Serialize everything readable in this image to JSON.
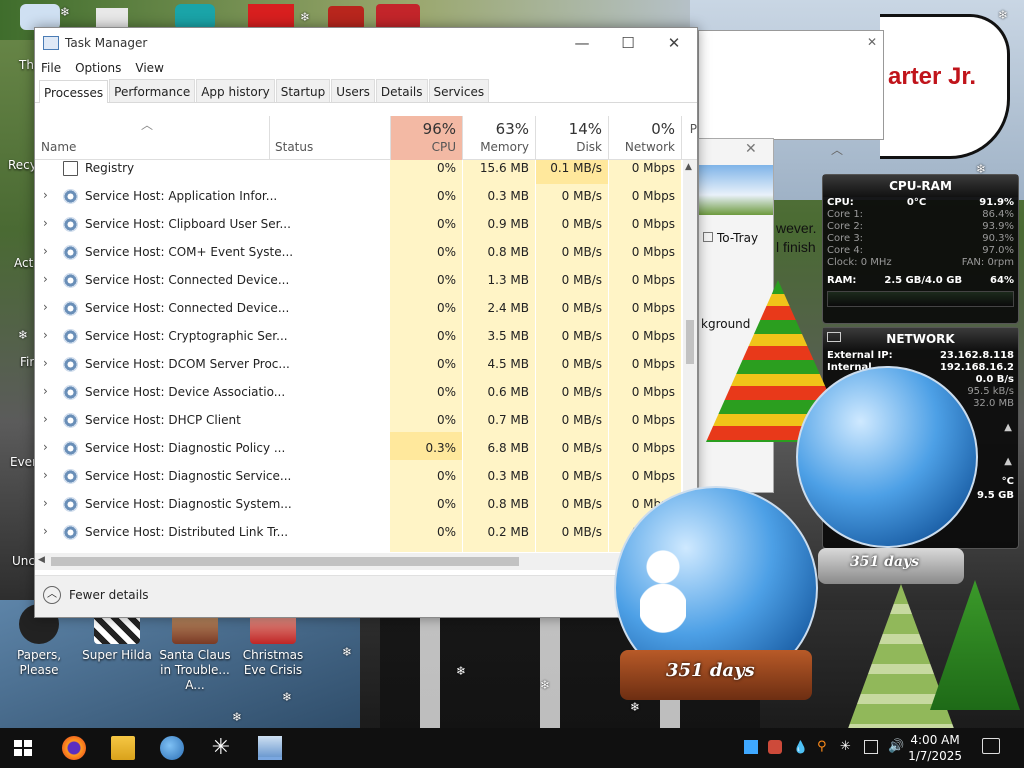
{
  "window": {
    "title": "Task Manager",
    "minimize": "—",
    "maximize": "☐",
    "close": "✕"
  },
  "menu": [
    "File",
    "Options",
    "View"
  ],
  "tabs": [
    "Processes",
    "Performance",
    "App history",
    "Startup",
    "Users",
    "Details",
    "Services"
  ],
  "columns": {
    "name": "Name",
    "status": "Status",
    "cpu": {
      "pct": "96%",
      "label": "CPU"
    },
    "memory": {
      "pct": "63%",
      "label": "Memory"
    },
    "disk": {
      "pct": "14%",
      "label": "Disk"
    },
    "network": {
      "pct": "0%",
      "label": "Network"
    },
    "power": "P"
  },
  "rows": [
    {
      "name": "Registry",
      "cpu": "0%",
      "memory": "15.6 MB",
      "disk": "0.1 MB/s",
      "network": "0 Mbps",
      "expandable": false
    },
    {
      "name": "Service Host: Application Infor...",
      "cpu": "0%",
      "memory": "0.3 MB",
      "disk": "0 MB/s",
      "network": "0 Mbps",
      "expandable": true
    },
    {
      "name": "Service Host: Clipboard User Ser...",
      "cpu": "0%",
      "memory": "0.9 MB",
      "disk": "0 MB/s",
      "network": "0 Mbps",
      "expandable": true
    },
    {
      "name": "Service Host: COM+ Event Syste...",
      "cpu": "0%",
      "memory": "0.8 MB",
      "disk": "0 MB/s",
      "network": "0 Mbps",
      "expandable": true
    },
    {
      "name": "Service Host: Connected Device...",
      "cpu": "0%",
      "memory": "1.3 MB",
      "disk": "0 MB/s",
      "network": "0 Mbps",
      "expandable": true
    },
    {
      "name": "Service Host: Connected Device...",
      "cpu": "0%",
      "memory": "2.4 MB",
      "disk": "0 MB/s",
      "network": "0 Mbps",
      "expandable": true
    },
    {
      "name": "Service Host: Cryptographic Ser...",
      "cpu": "0%",
      "memory": "3.5 MB",
      "disk": "0 MB/s",
      "network": "0 Mbps",
      "expandable": true
    },
    {
      "name": "Service Host: DCOM Server Proc...",
      "cpu": "0%",
      "memory": "4.5 MB",
      "disk": "0 MB/s",
      "network": "0 Mbps",
      "expandable": true
    },
    {
      "name": "Service Host: Device Associatio...",
      "cpu": "0%",
      "memory": "0.6 MB",
      "disk": "0 MB/s",
      "network": "0 Mbps",
      "expandable": true
    },
    {
      "name": "Service Host: DHCP Client",
      "cpu": "0%",
      "memory": "0.7 MB",
      "disk": "0 MB/s",
      "network": "0 Mbps",
      "expandable": true
    },
    {
      "name": "Service Host: Diagnostic Policy ...",
      "cpu": "0.3%",
      "memory": "6.8 MB",
      "disk": "0 MB/s",
      "network": "0 Mbps",
      "expandable": true
    },
    {
      "name": "Service Host: Diagnostic Service...",
      "cpu": "0%",
      "memory": "0.3 MB",
      "disk": "0 MB/s",
      "network": "0 Mbps",
      "expandable": true
    },
    {
      "name": "Service Host: Diagnostic System...",
      "cpu": "0%",
      "memory": "0.8 MB",
      "disk": "0 MB/s",
      "network": "0 Mbps",
      "expandable": true
    },
    {
      "name": "Service Host: Distributed Link Tr...",
      "cpu": "0%",
      "memory": "0.2 MB",
      "disk": "0 MB/s",
      "network": "0 Mbps",
      "expandable": true
    }
  ],
  "footer": {
    "fewer_details": "Fewer details"
  },
  "desktop_icons": [
    {
      "label": "Papers, Please"
    },
    {
      "label": "Super Hilda"
    },
    {
      "label": "Santa Claus in Trouble... A..."
    },
    {
      "label": "Christmas Eve Crisis"
    }
  ],
  "desktop_left_labels": [
    "Th",
    "Recy",
    "Act",
    "Fir",
    "Ever",
    "Unc"
  ],
  "background_window": {
    "speech_text": "arter Jr.",
    "text1": "wever.",
    "text2": "l finish",
    "to_tray": "To-Tray",
    "background": "kground"
  },
  "cpu_ram_gadget": {
    "title": "CPU-RAM",
    "cpu_label": "CPU:",
    "cpu_temp": "0°C",
    "cpu_pct": "91.9%",
    "cores": [
      {
        "label": "Core 1:",
        "value": "86.4%"
      },
      {
        "label": "Core 2:",
        "value": "93.9%"
      },
      {
        "label": "Core 3:",
        "value": "90.3%"
      },
      {
        "label": "Core 4:",
        "value": "97.0%"
      }
    ],
    "clock": "Clock: 0 MHz",
    "fan": "FAN: 0rpm",
    "ram_label": "RAM:",
    "ram_used": "2.5 GB/4.0 GB",
    "ram_pct": "64%"
  },
  "network_gadget": {
    "title": "NETWORK",
    "external_label": "External IP:",
    "external_ip": "23.162.8.118",
    "internal_label": "Internal",
    "internal_ip": "192.168.16.2",
    "rate1": "0.0 B/s",
    "rate2": "95.5 kB/s",
    "rate3": "32.0 MB",
    "extra1": "°C",
    "extra2": "9.5 GB"
  },
  "globes": {
    "label_small": "351 days",
    "label_large": "351 days"
  },
  "taskbar": {
    "time": "4:00 AM",
    "date": "1/7/2025"
  }
}
